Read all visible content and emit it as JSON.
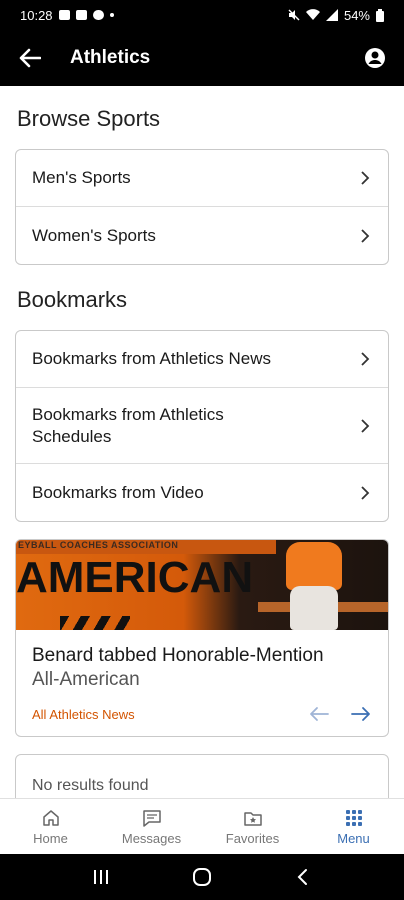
{
  "status_bar": {
    "time": "10:28",
    "battery": "54%"
  },
  "app_bar": {
    "title": "Athletics",
    "back_icon": "arrow-left-icon",
    "profile_icon": "account-circle-icon"
  },
  "browse": {
    "heading": "Browse Sports",
    "items": [
      {
        "label": "Men's Sports"
      },
      {
        "label": "Women's Sports"
      }
    ]
  },
  "bookmarks": {
    "heading": "Bookmarks",
    "items": [
      {
        "label": "Bookmarks from Athletics News"
      },
      {
        "label": "Bookmarks from Athletics Schedules"
      },
      {
        "label": "Bookmarks from Video"
      }
    ]
  },
  "news": {
    "image_banner_text": "EYBALL COACHES ASSOCIATION",
    "image_headline": "AMERICAN",
    "title": "Benard tabbed Honorable-Mention",
    "subtitle": "All-American",
    "link": "All Athletics News",
    "colors": {
      "link": "#d35400",
      "arrow": "#3b6fb3"
    }
  },
  "empty_state": {
    "text": "No results found"
  },
  "bottom_nav": {
    "items": [
      {
        "label": "Home",
        "icon": "home-icon"
      },
      {
        "label": "Messages",
        "icon": "message-icon"
      },
      {
        "label": "Favorites",
        "icon": "folder-star-icon"
      },
      {
        "label": "Menu",
        "icon": "grid-menu-icon",
        "active": true
      }
    ],
    "active_color": "#3b6fb3"
  }
}
